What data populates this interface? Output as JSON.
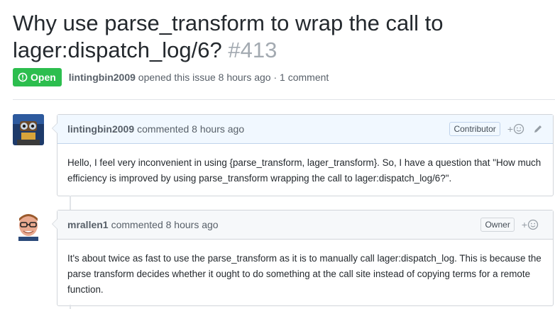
{
  "issue": {
    "title": "Why use parse_transform to wrap the call to lager:dispatch_log/6?",
    "number": "#413",
    "state": "Open",
    "author": "lintingbin2009",
    "opened_text": "opened this issue 8 hours ago · 1 comment"
  },
  "comments": [
    {
      "author": "lintingbin2009",
      "action": "commented 8 hours ago",
      "badge": "Contributor",
      "reaction_label": "+",
      "body": "Hello, I feel very inconvenient in using {parse_transform, lager_transform}. So, I have a question that \"How much efficiency is improved by using parse_transform wrapping the call to lager:dispatch_log/6?\"."
    },
    {
      "author": "mrallen1",
      "action": "commented 8 hours ago",
      "badge": "Owner",
      "reaction_label": "+",
      "body": "It's about twice as fast to use the parse_transform as it is to manually call lager:dispatch_log. This is because the parse transform decides whether it ought to do something at the call site instead of copying terms for a remote function."
    }
  ],
  "colors": {
    "open_badge": "#2cbe4e",
    "header_blue": "#f1f8ff",
    "header_gray": "#f6f8fa",
    "number_gray": "#a3aab1"
  },
  "icons": [
    "issue-opened-icon",
    "smiley-icon",
    "pencil-icon"
  ]
}
